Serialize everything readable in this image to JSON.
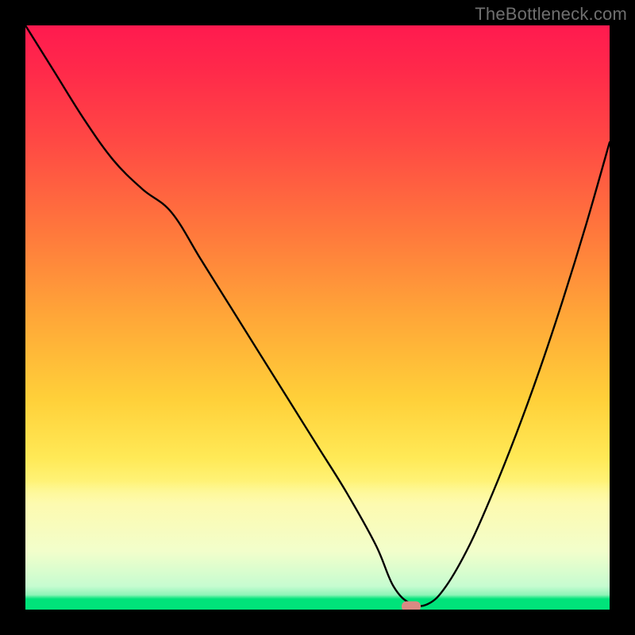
{
  "watermark": "TheBottleneck.com",
  "marker": {
    "x_pct": 66,
    "y_pct": 99.5,
    "color": "#d98a83"
  },
  "chart_data": {
    "type": "line",
    "title": "",
    "xlabel": "",
    "ylabel": "",
    "xlim": [
      0,
      100
    ],
    "ylim": [
      0,
      100
    ],
    "grid": false,
    "legend": false,
    "annotation": "Gradient background: red (top) → orange → yellow → pale yellow → green (bottom). Black V-shaped curve with minimum near x≈66.",
    "series": [
      {
        "name": "curve",
        "x": [
          0,
          5,
          10,
          15,
          20,
          25,
          30,
          35,
          40,
          45,
          50,
          55,
          60,
          63,
          66,
          69,
          72,
          76,
          80,
          84,
          88,
          92,
          96,
          100
        ],
        "y": [
          100,
          92,
          84,
          77,
          72,
          68,
          60,
          52,
          44,
          36,
          28,
          20,
          11,
          4,
          1,
          1,
          4,
          11,
          20,
          30,
          41,
          53,
          66,
          80
        ]
      }
    ],
    "marker_point": {
      "x": 66,
      "y": 0.5
    }
  }
}
